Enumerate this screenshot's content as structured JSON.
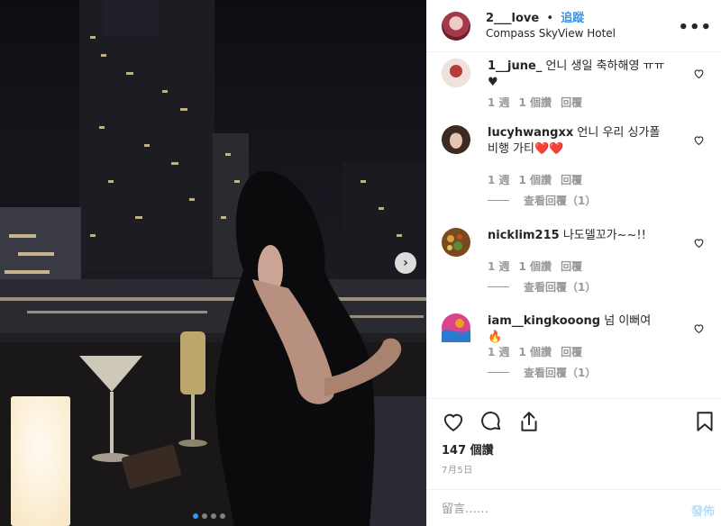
{
  "post": {
    "username": "2___love",
    "separator": "•",
    "follow_label": "追蹤",
    "location": "Compass SkyView Hotel",
    "more_icon": "more-options-icon"
  },
  "photo": {
    "carousel_count": 4,
    "carousel_active": 1
  },
  "comments": [
    {
      "user": "1__june_",
      "text": "언니 생일 축하해영 ㅠㅠ♥",
      "time": "1 週",
      "likes": "1 個讚",
      "reply": "回覆",
      "avatar_color": "#e8d8d0"
    },
    {
      "user": "lucyhwangxx",
      "text": "언니 우리 싱가폴비행 가티❤️❤️",
      "time": "1 週",
      "likes": "1 個讚",
      "reply": "回覆",
      "view_replies": "查看回覆（1）",
      "avatar_color": "#4a3028"
    },
    {
      "user": "nicklim215",
      "text": "나도델꼬가~~!!",
      "time": "1 週",
      "likes": "1 個讚",
      "reply": "回覆",
      "view_replies": "查看回覆（1）",
      "avatar_color": "#8a5a2a"
    },
    {
      "user": "iam__kingkooong",
      "text": "넘 이뻐여 🔥",
      "time": "1 週",
      "likes": "1 個讚",
      "reply": "回覆",
      "view_replies": "查看回覆（1）",
      "avatar_color": "#d24a8a"
    }
  ],
  "stats": {
    "likes": "147 個讚",
    "date": "7月5日"
  },
  "composer": {
    "placeholder": "留言……",
    "post_label": "發佈"
  },
  "colors": {
    "accent": "#3897f0",
    "post_disabled": "#b2dffc",
    "text": "#262626",
    "muted": "#8e8e8e"
  }
}
